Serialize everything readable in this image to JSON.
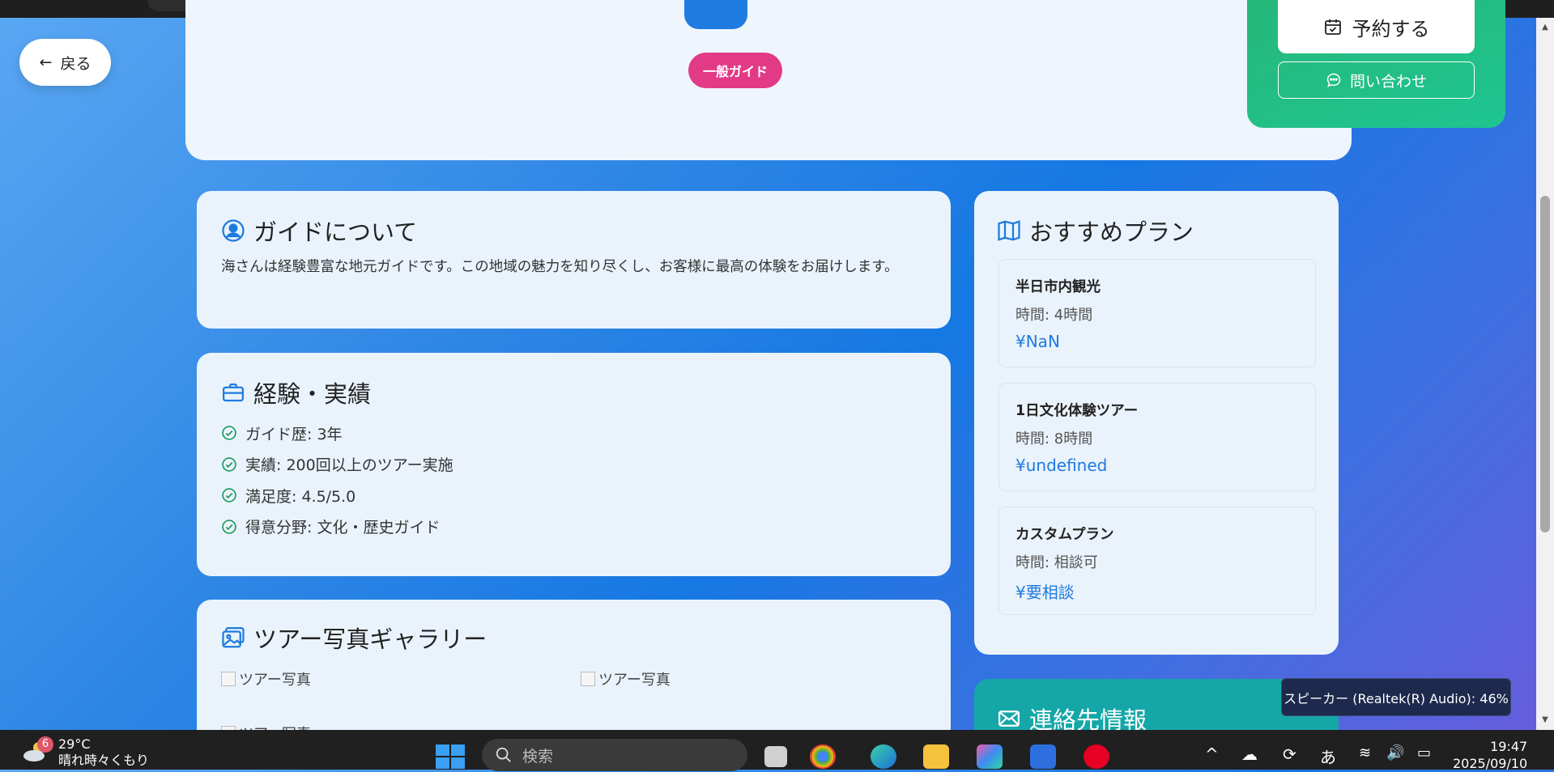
{
  "nav": {
    "back_label": "戻る"
  },
  "profile": {
    "badge_label": "一般ガイド",
    "book_label": "予約する",
    "inquiry_label": "問い合わせ"
  },
  "about": {
    "title": "ガイドについて",
    "text": "海さんは経験豊富な地元ガイドです。この地域の魅力を知り尽くし、お客様に最高の体験をお届けします。"
  },
  "experience": {
    "title": "経験・実績",
    "items": [
      "ガイド歴: 3年",
      "実績: 200回以上のツアー実施",
      "満足度: 4.5/5.0",
      "得意分野: 文化・歴史ガイド"
    ]
  },
  "gallery": {
    "title": "ツアー写真ギャラリー",
    "images": [
      "ツアー写真",
      "ツアー写真",
      "ツアー写真"
    ]
  },
  "plans": {
    "title": "おすすめプラン",
    "items": [
      {
        "name": "半日市内観光",
        "time": "時間: 4時間",
        "price": "¥NaN"
      },
      {
        "name": "1日文化体験ツアー",
        "time": "時間: 8時間",
        "price": "¥undefined"
      },
      {
        "name": "カスタムプラン",
        "time": "時間: 相談可",
        "price": "¥要相談"
      }
    ]
  },
  "contact": {
    "title": "連絡先情報"
  },
  "tooltip": {
    "text": "スピーカー (Realtek(R) Audio): 46%"
  },
  "taskbar": {
    "weather_badge": "6",
    "temperature": "29°C",
    "weather_desc": "晴れ時々くもり",
    "search_placeholder": "検索",
    "ime_label": "あ",
    "time": "19:47",
    "date": "2025/09/10"
  },
  "colors": {
    "accent_blue": "#1e7be0",
    "badge_pink": "#e23a86",
    "booking_green": "#25b77a",
    "contact_teal": "#15a7a7"
  }
}
